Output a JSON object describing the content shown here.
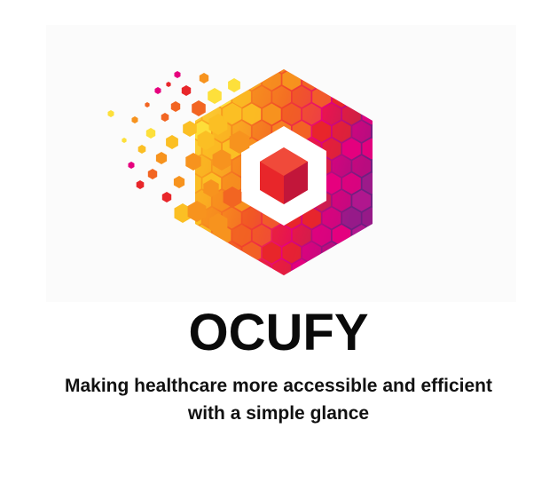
{
  "brand": {
    "name": "OCUFY",
    "tagline": "Making healthcare more accessible and efficient with a simple glance"
  },
  "logo": {
    "icon": "hexagon-mosaic-icon",
    "palette": [
      "#fde03b",
      "#fbbf24",
      "#f7931e",
      "#f26522",
      "#e8262a",
      "#e6007e",
      "#b5178f",
      "#7b2d8b",
      "#5b1a6b"
    ]
  }
}
